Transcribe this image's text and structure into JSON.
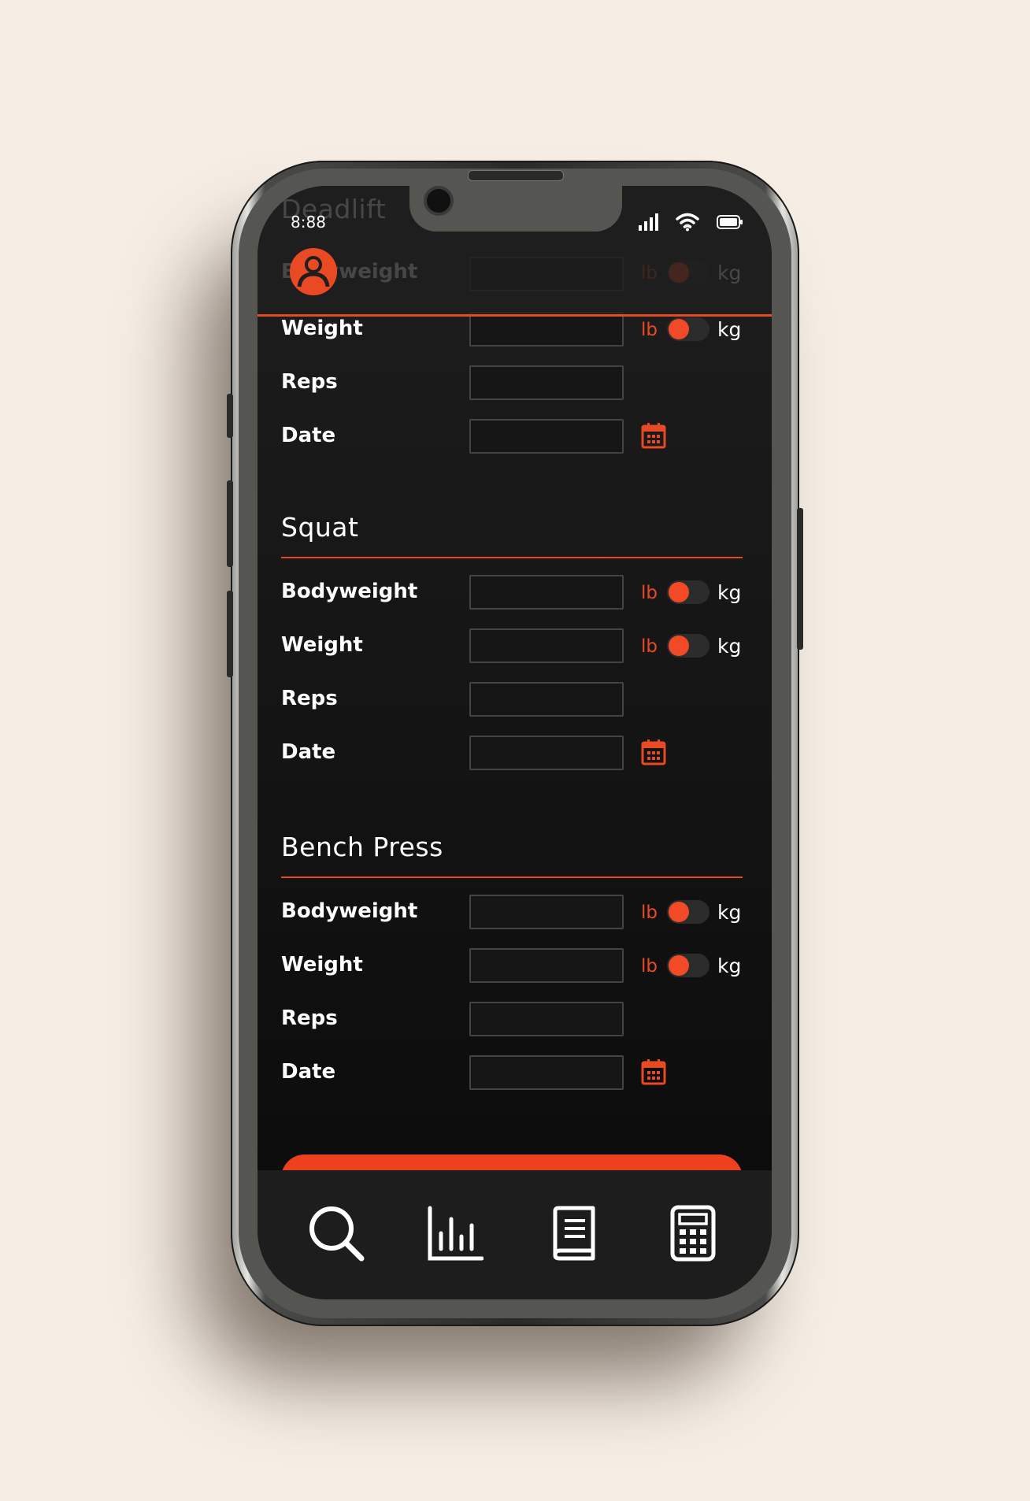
{
  "status": {
    "time": "8:88",
    "icons": [
      "signal-icon",
      "wifi-icon",
      "battery-icon"
    ]
  },
  "header": {
    "faded_title": "Deadlift",
    "faded_row_label": "Bodyweight",
    "faded_unit_lb": "lb",
    "faded_unit_kg": "kg",
    "avatar_icon": "user-avatar-icon"
  },
  "deadlift": {
    "rows": {
      "weight": {
        "label": "Weight",
        "value": "",
        "unit_lb": "lb",
        "unit_kg": "kg"
      },
      "reps": {
        "label": "Reps",
        "value": ""
      },
      "date": {
        "label": "Date",
        "value": ""
      }
    }
  },
  "squat": {
    "title": "Squat",
    "rows": {
      "bodyweight": {
        "label": "Bodyweight",
        "value": "",
        "unit_lb": "lb",
        "unit_kg": "kg"
      },
      "weight": {
        "label": "Weight",
        "value": "",
        "unit_lb": "lb",
        "unit_kg": "kg"
      },
      "reps": {
        "label": "Reps",
        "value": ""
      },
      "date": {
        "label": "Date",
        "value": ""
      }
    }
  },
  "bench": {
    "title": "Bench Press",
    "rows": {
      "bodyweight": {
        "label": "Bodyweight",
        "value": "",
        "unit_lb": "lb",
        "unit_kg": "kg"
      },
      "weight": {
        "label": "Weight",
        "value": "",
        "unit_lb": "lb",
        "unit_kg": "kg"
      },
      "reps": {
        "label": "Reps",
        "value": ""
      },
      "date": {
        "label": "Date",
        "value": ""
      }
    }
  },
  "tabbar": {
    "tabs": [
      "search-icon",
      "bar-chart-icon",
      "book-icon",
      "calculator-icon"
    ]
  },
  "colors": {
    "accent": "#e94a24",
    "background": "#1a1a1a",
    "page_bg": "#f6eee5"
  }
}
